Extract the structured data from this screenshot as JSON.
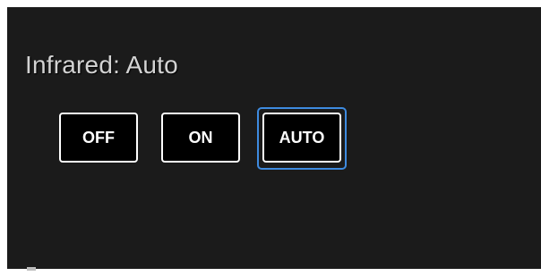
{
  "infrared": {
    "title": "Infrared: Auto",
    "options": {
      "off_label": "OFF",
      "on_label": "ON",
      "auto_label": "AUTO"
    },
    "selected": "AUTO",
    "focus_color": "#3e8be0"
  }
}
